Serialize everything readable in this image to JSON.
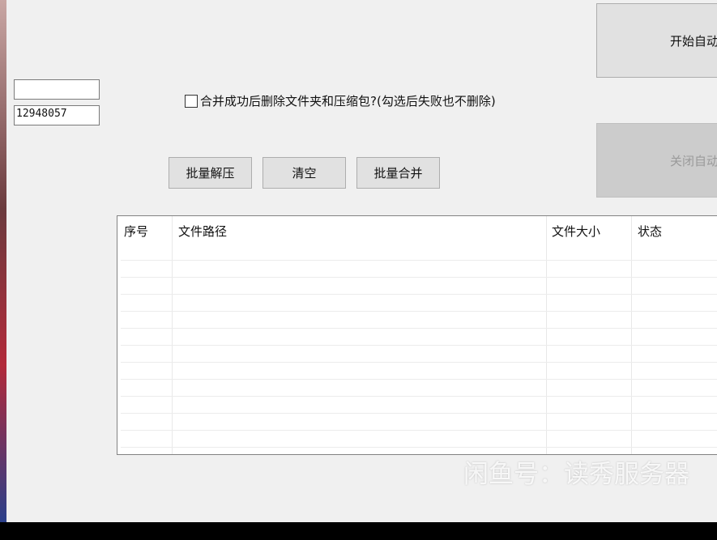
{
  "inputs": {
    "top_value": "",
    "id_value": "12948057"
  },
  "checkbox": {
    "label": "合并成功后删除文件夹和压缩包?(勾选后失败也不删除)",
    "checked": false
  },
  "buttons": {
    "batch_extract": "批量解压",
    "clear": "清空",
    "batch_merge": "批量合并",
    "start_auto": "开始自动",
    "stop_auto": "关闭自动"
  },
  "table": {
    "columns": [
      "序号",
      "文件路径",
      "文件大小",
      "状态"
    ],
    "rows": []
  },
  "watermark": "闲鱼号：读秀服务器"
}
